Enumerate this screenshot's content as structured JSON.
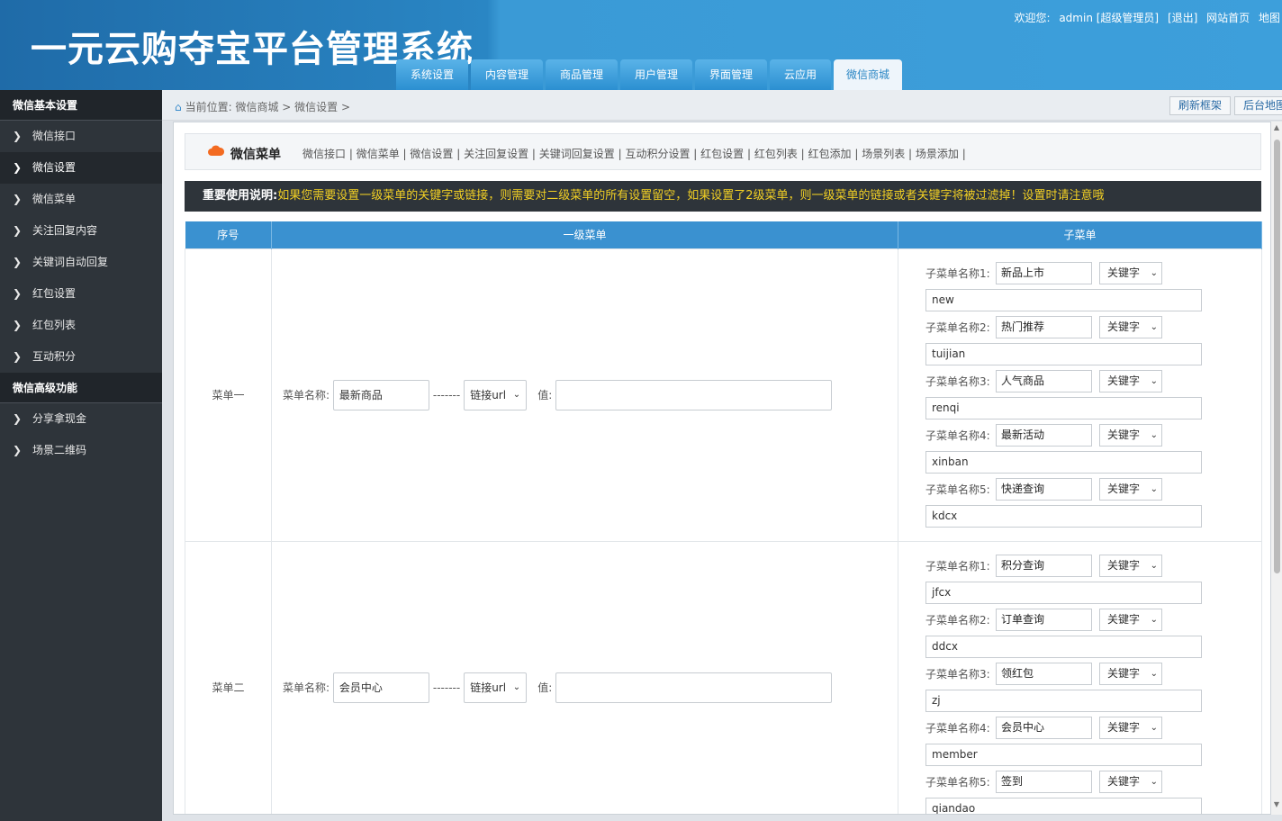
{
  "header": {
    "logo": "一元云购夺宝平台管理系统",
    "welcome": "欢迎您:",
    "user": "admin [超级管理员]",
    "logout": "[退出]",
    "site_home": "网站首页",
    "map": "地图"
  },
  "nav": {
    "tabs": [
      {
        "label": "系统设置"
      },
      {
        "label": "内容管理"
      },
      {
        "label": "商品管理"
      },
      {
        "label": "用户管理"
      },
      {
        "label": "界面管理"
      },
      {
        "label": "云应用"
      },
      {
        "label": "微信商城"
      }
    ]
  },
  "sidebar": {
    "section1": "微信基本设置",
    "items1": [
      {
        "label": "微信接口"
      },
      {
        "label": "微信设置"
      },
      {
        "label": "微信菜单"
      },
      {
        "label": "关注回复内容"
      },
      {
        "label": "关键词自动回复"
      },
      {
        "label": "红包设置"
      },
      {
        "label": "红包列表"
      },
      {
        "label": "互动积分"
      }
    ],
    "section2": "微信高级功能",
    "items2": [
      {
        "label": "分享拿现金"
      },
      {
        "label": "场景二维码"
      }
    ]
  },
  "crumb": {
    "text": "当前位置: 微信商城 > 微信设置 >",
    "refresh": "刷新框架",
    "backend_map": "后台地图"
  },
  "subtabs": {
    "title": "微信菜单",
    "links": [
      "微信接口",
      "微信菜单",
      "微信设置",
      "关注回复设置",
      "关键词回复设置",
      "互动积分设置",
      "红包设置",
      "红包列表",
      "红包添加",
      "场景列表",
      "场景添加"
    ]
  },
  "notice": {
    "label": "重要使用说明:",
    "text": "如果您需要设置一级菜单的关键字或链接，则需要对二级菜单的所有设置留空，如果设置了2级菜单，则一级菜单的链接或者关键字将被过滤掉！设置时请注意哦"
  },
  "table": {
    "headers": {
      "no": "序号",
      "level1": "一级菜单",
      "sub": "子菜单"
    },
    "menu_name_label": "菜单名称:",
    "dash": "-------",
    "value_label": "值:",
    "sub_label_prefix": "子菜单名称",
    "menus": [
      {
        "no": "菜单一",
        "name": "最新商品",
        "type": "链接url",
        "value": "",
        "subs": [
          {
            "label": "子菜单名称1:",
            "name": "新品上市",
            "type": "关键字",
            "key": "new"
          },
          {
            "label": "子菜单名称2:",
            "name": "热门推荐",
            "type": "关键字",
            "key": "tuijian"
          },
          {
            "label": "子菜单名称3:",
            "name": "人气商品",
            "type": "关键字",
            "key": "renqi"
          },
          {
            "label": "子菜单名称4:",
            "name": "最新活动",
            "type": "关键字",
            "key": "xinban"
          },
          {
            "label": "子菜单名称5:",
            "name": "快递查询",
            "type": "关键字",
            "key": "kdcx"
          }
        ]
      },
      {
        "no": "菜单二",
        "name": "会员中心",
        "type": "链接url",
        "value": "",
        "subs": [
          {
            "label": "子菜单名称1:",
            "name": "积分查询",
            "type": "关键字",
            "key": "jfcx"
          },
          {
            "label": "子菜单名称2:",
            "name": "订单查询",
            "type": "关键字",
            "key": "ddcx"
          },
          {
            "label": "子菜单名称3:",
            "name": "领红包",
            "type": "关键字",
            "key": "zj"
          },
          {
            "label": "子菜单名称4:",
            "name": "会员中心",
            "type": "关键字",
            "key": "member"
          },
          {
            "label": "子菜单名称5:",
            "name": "签到",
            "type": "关键字",
            "key": "qiandao"
          }
        ]
      }
    ]
  },
  "colors": {
    "header_blue": "#2a86c4",
    "sidebar_dark": "#2e343a",
    "notice_yellow": "#f2d024",
    "table_header": "#3a91d0"
  }
}
